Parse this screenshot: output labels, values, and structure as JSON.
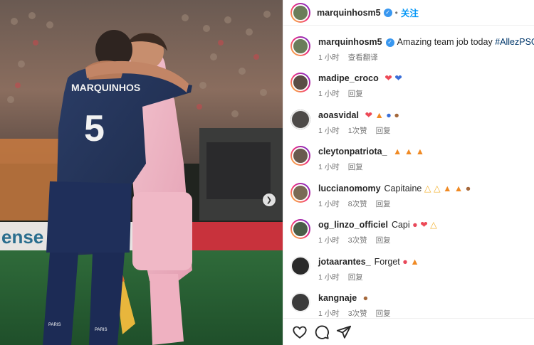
{
  "post": {
    "username": "marquinhosm5",
    "follow_label": "关注",
    "jersey_name": "MARQUINHOS",
    "jersey_number": "5",
    "ad_board_text": "ense",
    "sock_text": "PARIS"
  },
  "comments": [
    {
      "user": "marquinhosm5",
      "text": "Amazing team job today",
      "hashtag": "#AllezPSG",
      "time": "1 小时",
      "action": "查看翻译",
      "likes": ""
    },
    {
      "user": "madipe_croco",
      "text": "",
      "time": "1 小时",
      "action": "回复",
      "likes": ""
    },
    {
      "user": "aoasvidal",
      "text": "",
      "time": "1 小时",
      "likes": "1次赞",
      "action": "回复"
    },
    {
      "user": "cleytonpatriota_",
      "text": "",
      "time": "1 小时",
      "action": "回复",
      "likes": ""
    },
    {
      "user": "luccianomomy",
      "text": "Capitaine",
      "time": "1 小时",
      "likes": "8次赞",
      "action": "回复"
    },
    {
      "user": "og_linzo_officiel",
      "text": "Capi",
      "time": "1 小时",
      "likes": "3次赞",
      "action": "回复"
    },
    {
      "user": "jotaarantes_",
      "text": "Forget",
      "time": "1 小时",
      "action": "回复",
      "likes": ""
    },
    {
      "user": "kangnaje",
      "text": "",
      "time": "1 小时",
      "likes": "3次赞",
      "action": "回复"
    }
  ],
  "icons": [
    "heart-icon",
    "comment-icon",
    "share-icon",
    "chevron-right-icon",
    "verified-icon"
  ],
  "colors": {
    "accent": "#0095f6",
    "verified": "#3897f0",
    "red_heart": "#ed4956",
    "blue_heart": "#3b6fd8"
  }
}
